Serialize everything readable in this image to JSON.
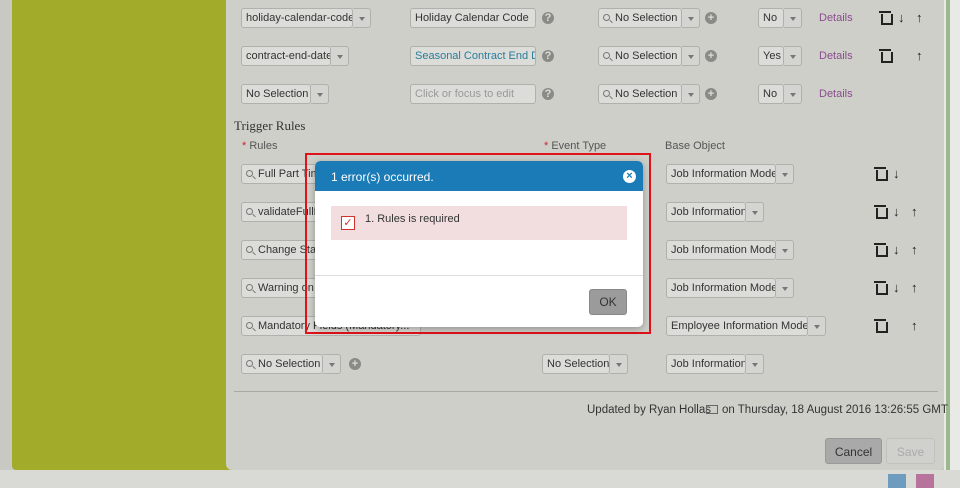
{
  "rows_top": [
    {
      "field": "holiday-calendar-code",
      "label": "Holiday Calendar Code",
      "label_style": "normal",
      "selection": "No Selection",
      "flag": "No",
      "details": "Details"
    },
    {
      "field": "contract-end-date",
      "label": "Seasonal Contract End Da",
      "label_style": "blue",
      "selection": "No Selection",
      "flag": "Yes",
      "details": "Details"
    },
    {
      "field": "No Selection",
      "label": "Click or focus to edit",
      "label_style": "placeholder",
      "selection": "No Selection",
      "flag": "No",
      "details": "Details"
    }
  ],
  "trigger": {
    "title": "Trigger Rules",
    "rules_header": "Rules",
    "event_type_header": "Event Type",
    "base_object_header": "Base Object",
    "required_mark": "*",
    "rules": [
      {
        "rule": "Full Part Tim",
        "base_object": "Job Information Model"
      },
      {
        "rule": "validateFullP",
        "base_object": "Job Information"
      },
      {
        "rule": "Change Sta",
        "base_object": "Job Information Model"
      },
      {
        "rule": "Warning on C",
        "base_object": "Job Information Model"
      },
      {
        "rule": "Mandatory Fields (Mandatory...",
        "base_object": "Employee Information Mode..."
      }
    ],
    "new_rule": {
      "rule": "No Selection",
      "event_type": "No Selection",
      "base_object": "Job Information"
    }
  },
  "footer": {
    "updated_text": "Updated by Ryan Hollas",
    "updated_on": "on Thursday, 18 August 2016 13:26:55 GMT",
    "cancel": "Cancel",
    "save": "Save"
  },
  "dialog": {
    "title": "1 error(s) occurred.",
    "close_glyph": "×",
    "error": "1. Rules is required",
    "check_glyph": "✓",
    "ok": "OK"
  },
  "icons": {
    "add": "+",
    "info": "?",
    "down_arrow": "↓",
    "up_arrow": "↑"
  },
  "colors": {
    "dialog_header": "#1a7bb7",
    "error_bg": "#f2dede",
    "highlight": "#e0121a",
    "sidebar": "#a3ac2a",
    "details_link": "#8a4b8f"
  }
}
